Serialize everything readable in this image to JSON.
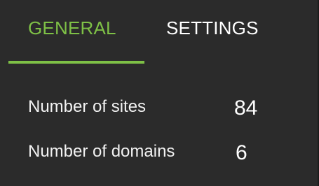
{
  "colors": {
    "background": "#2b2b2b",
    "accent": "#7ec046",
    "text": "#f2f2f2"
  },
  "tabs": {
    "general_label": "GENERAL",
    "settings_label": "SETTINGS",
    "active": "GENERAL"
  },
  "stats": {
    "sites_label": "Number of sites",
    "sites_value": "84",
    "domains_label": "Number of domains",
    "domains_value": "6"
  }
}
